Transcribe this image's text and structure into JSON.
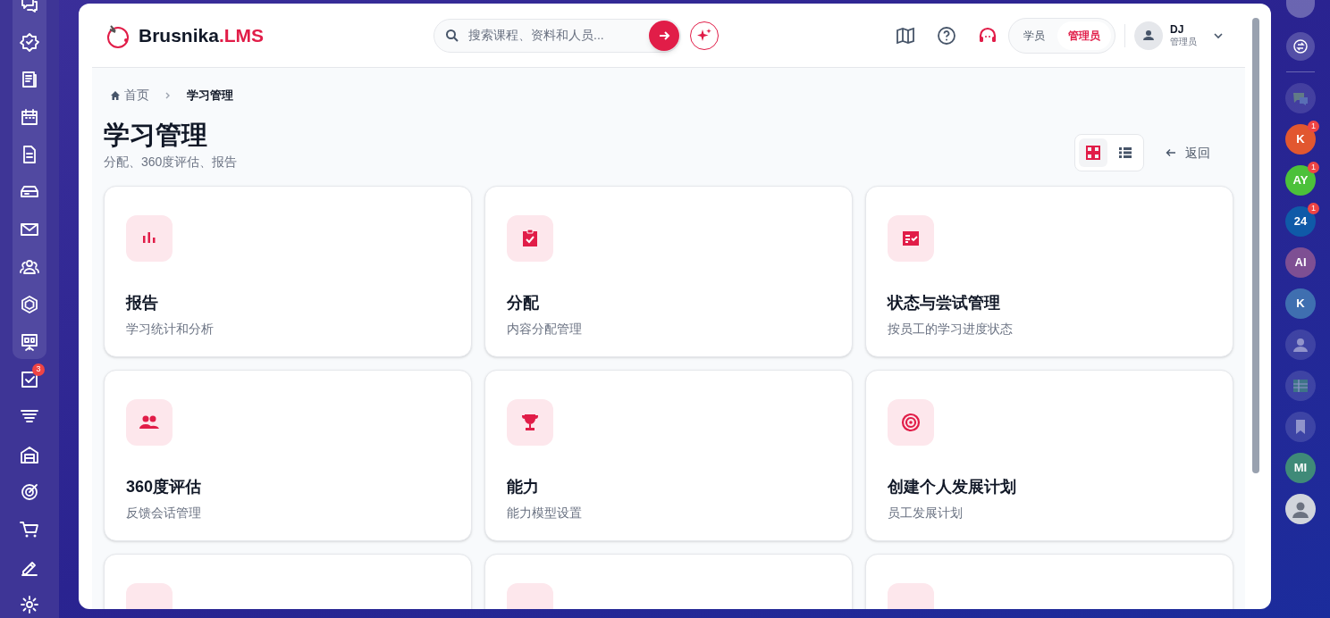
{
  "left_rail": {
    "badge": "3"
  },
  "brand": {
    "name": "Brusnika",
    "suffix": ".LMS"
  },
  "search": {
    "placeholder": "搜索课程、资料和人员..."
  },
  "roles": [
    {
      "label": "学员",
      "selected": false
    },
    {
      "label": "管理员",
      "selected": true
    }
  ],
  "user": {
    "name": "DJ",
    "role": "管理员"
  },
  "breadcrumb": [
    "首页",
    "学习管理"
  ],
  "page": {
    "title": "学习管理",
    "subtitle": "分配、360度评估、报告"
  },
  "view_toggle": [
    {
      "kind": "grid",
      "selected": true
    },
    {
      "kind": "list",
      "selected": false
    }
  ],
  "back": "返回",
  "cards": [
    {
      "kind": "chart",
      "title": "报告",
      "description": "学习统计和分析"
    },
    {
      "kind": "clipboard",
      "title": "分配",
      "description": "内容分配管理"
    },
    {
      "kind": "checklist",
      "title": "状态与尝试管理",
      "description": "按员工的学习进度状态"
    },
    {
      "kind": "people",
      "title": "360度评估",
      "description": "反馈会话管理"
    },
    {
      "kind": "trophy",
      "title": "能力",
      "description": "能力模型设置"
    },
    {
      "kind": "target",
      "title": "创建个人发展计划",
      "description": "员工发展计划"
    },
    {
      "kind": "cut"
    },
    {
      "kind": "cut"
    },
    {
      "kind": "cut"
    }
  ],
  "dock": [
    {
      "kind": "chat",
      "dimmed": true
    },
    {
      "kind": "initials",
      "initials": "K",
      "color": "#e2572f",
      "badge": "1",
      "dimmed": false
    },
    {
      "kind": "initials",
      "initials": "AY",
      "color": "#4cc13a",
      "badge": "1",
      "dimmed": false
    },
    {
      "kind": "initials",
      "initials": "24",
      "color": "#0f5aa8",
      "badge": "1",
      "dimmed": false
    },
    {
      "kind": "initials",
      "initials": "AI",
      "color": "#7e4f93"
    },
    {
      "kind": "initials",
      "initials": "K",
      "color": "#3f6fb0"
    },
    {
      "kind": "person",
      "dimmed": true
    },
    {
      "kind": "table",
      "dimmed": true
    },
    {
      "kind": "bookmark",
      "dimmed": true
    },
    {
      "kind": "initials",
      "initials": "MI",
      "color": "#3f8a78"
    },
    {
      "kind": "avatar",
      "dimmed": false
    }
  ]
}
